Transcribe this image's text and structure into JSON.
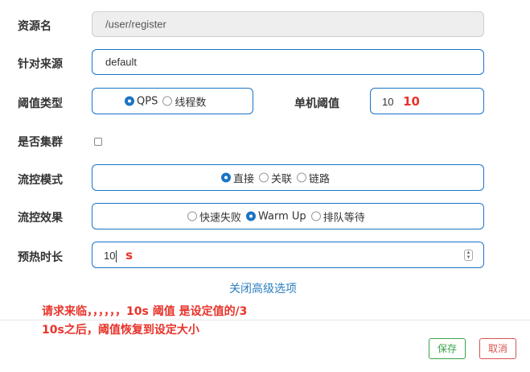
{
  "form": {
    "resource": {
      "label": "资源名",
      "value": "/user/register"
    },
    "origin": {
      "label": "针对来源",
      "value": "default"
    },
    "threshold_type": {
      "label": "阈值类型",
      "options": [
        {
          "label": "QPS",
          "selected": true
        },
        {
          "label": "线程数",
          "selected": false
        }
      ]
    },
    "single_threshold": {
      "label": "单机阈值",
      "value": "10",
      "annotation": "10"
    },
    "cluster": {
      "label": "是否集群",
      "checked": false
    },
    "flow_mode": {
      "label": "流控模式",
      "options": [
        {
          "label": "直接",
          "selected": true
        },
        {
          "label": "关联",
          "selected": false
        },
        {
          "label": "链路",
          "selected": false
        }
      ]
    },
    "flow_effect": {
      "label": "流控效果",
      "options": [
        {
          "label": "快速失败",
          "selected": false
        },
        {
          "label": "Warm Up",
          "selected": true
        },
        {
          "label": "排队等待",
          "selected": false
        }
      ]
    },
    "warmup": {
      "label": "预热时长",
      "value": "10",
      "annotation": "s"
    },
    "advanced_link": "关闭高级选项"
  },
  "notes": [
    "请求来临，，，，，，10s 阈值 是设定值的/3",
    "10s之后，阈值恢复到设定大小"
  ],
  "footer": {
    "save_label": "保存",
    "cancel_label": "取消"
  },
  "colors": {
    "accent": "#1b74c5",
    "annotation": "#e8332a",
    "save": "#3aa34a",
    "cancel": "#d9534f"
  }
}
